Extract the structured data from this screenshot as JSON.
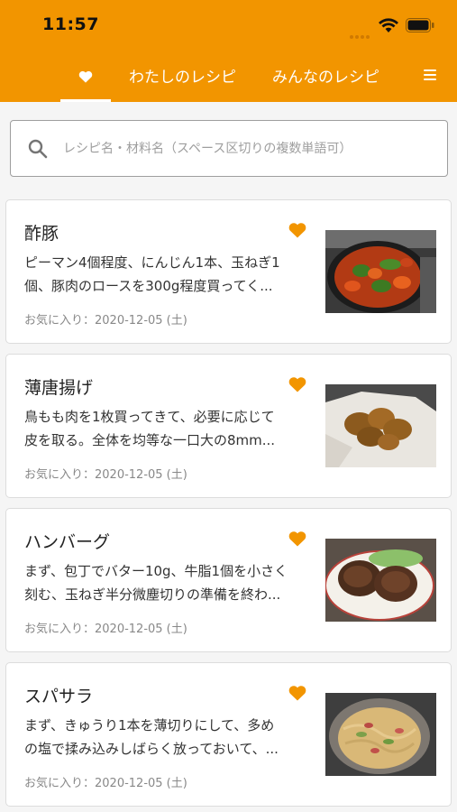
{
  "status_bar": {
    "time": "11:57"
  },
  "tabs": {
    "favorites_icon": "heart-icon",
    "mine_label": "わたしのレシピ",
    "all_label": "みんなのレシピ",
    "menu_icon": "hamburger-menu-icon"
  },
  "search": {
    "placeholder": "レシピ名・材料名（スペース区切りの複数単語可）",
    "value": ""
  },
  "colors": {
    "accent": "#f29500",
    "heart": "#f29500"
  },
  "recipes": [
    {
      "title": "酢豚",
      "desc_line1": "ピーマン4個程度、にんじん1本、玉ねぎ1",
      "desc_line2": "個、豚肉のロースを300g程度買ってく...",
      "date": "お気に入り：2020-12-05 (土)",
      "favorited": true,
      "thumb": "sweet-and-sour-pork-photo"
    },
    {
      "title": "薄唐揚げ",
      "desc_line1": "鳥もも肉を1枚買ってきて、必要に応じて",
      "desc_line2": "皮を取る。全体を均等な一口大の8mm...",
      "date": "お気に入り：2020-12-05 (土)",
      "favorited": true,
      "thumb": "fried-chicken-photo"
    },
    {
      "title": "ハンバーグ",
      "desc_line1": "まず、包丁でバター10g、牛脂1個を小さく",
      "desc_line2": "刻む、玉ねぎ半分微塵切りの準備を終わ...",
      "date": "お気に入り：2020-12-05 (土)",
      "favorited": true,
      "thumb": "hamburg-steak-photo"
    },
    {
      "title": "スパサラ",
      "desc_line1": "まず、きゅうり1本を薄切りにして、多め",
      "desc_line2": "の塩で揉み込みしばらく放っておいて、...",
      "date": "お気に入り：2020-12-05 (土)",
      "favorited": true,
      "thumb": "spaghetti-salad-photo"
    }
  ]
}
